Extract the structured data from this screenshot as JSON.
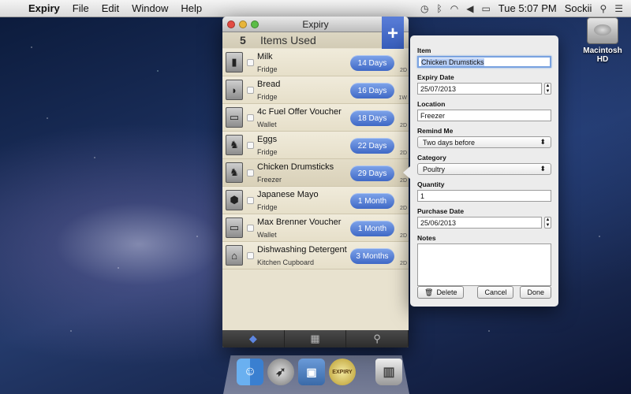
{
  "menubar": {
    "app_name": "Expiry",
    "menus": [
      "File",
      "Edit",
      "Window",
      "Help"
    ],
    "clock": "Tue 5:07 PM",
    "user": "Sockii"
  },
  "desktop": {
    "drive_label": "Macintosh HD"
  },
  "window": {
    "title": "Expiry",
    "header_count": "5",
    "header_label": "Items Used",
    "add_button": "+",
    "items": [
      {
        "name": "Milk",
        "location": "Fridge",
        "expiry": "14 Days",
        "tag": "2D",
        "icon": "milk-carton-icon",
        "glyph": "▮"
      },
      {
        "name": "Bread",
        "location": "Fridge",
        "expiry": "16 Days",
        "tag": "1W",
        "icon": "bread-icon",
        "glyph": "◗"
      },
      {
        "name": "4c Fuel Offer Voucher",
        "location": "Wallet",
        "expiry": "18 Days",
        "tag": "2D",
        "icon": "voucher-icon",
        "glyph": "▭"
      },
      {
        "name": "Eggs",
        "location": "Fridge",
        "expiry": "22 Days",
        "tag": "2D",
        "icon": "chicken-icon",
        "glyph": "♞"
      },
      {
        "name": "Chicken Drumsticks",
        "location": "Freezer",
        "expiry": "29 Days",
        "tag": "2D",
        "icon": "chicken-icon",
        "glyph": "♞"
      },
      {
        "name": "Japanese Mayo",
        "location": "Fridge",
        "expiry": "1 Month",
        "tag": "2D",
        "icon": "jar-icon",
        "glyph": "⬢"
      },
      {
        "name": "Max Brenner Voucher",
        "location": "Wallet",
        "expiry": "1 Month",
        "tag": "2D",
        "icon": "voucher-icon",
        "glyph": "▭"
      },
      {
        "name": "Dishwashing Detergent",
        "location": "Kitchen Cupboard",
        "expiry": "3 Months",
        "tag": "2D",
        "icon": "house-icon",
        "glyph": "⌂"
      }
    ],
    "toolbar": [
      "tag-icon",
      "calendar-icon",
      "search-icon"
    ]
  },
  "detail": {
    "item_label": "Item",
    "item_value": "Chicken Drumsticks",
    "expiry_label": "Expiry Date",
    "expiry_value": "25/07/2013",
    "location_label": "Location",
    "location_value": "Freezer",
    "remind_label": "Remind Me",
    "remind_value": "Two days before",
    "category_label": "Category",
    "category_value": "Poultry",
    "quantity_label": "Quantity",
    "quantity_value": "1",
    "purchase_label": "Purchase Date",
    "purchase_value": "25/06/2013",
    "notes_label": "Notes",
    "notes_value": "",
    "delete_label": "Delete",
    "cancel_label": "Cancel",
    "done_label": "Done"
  },
  "dock": {
    "expiry_icon_text": "EXPIRY"
  },
  "colors": {
    "accent": "#3f68c6",
    "window_bg": "#e8e2cf"
  }
}
